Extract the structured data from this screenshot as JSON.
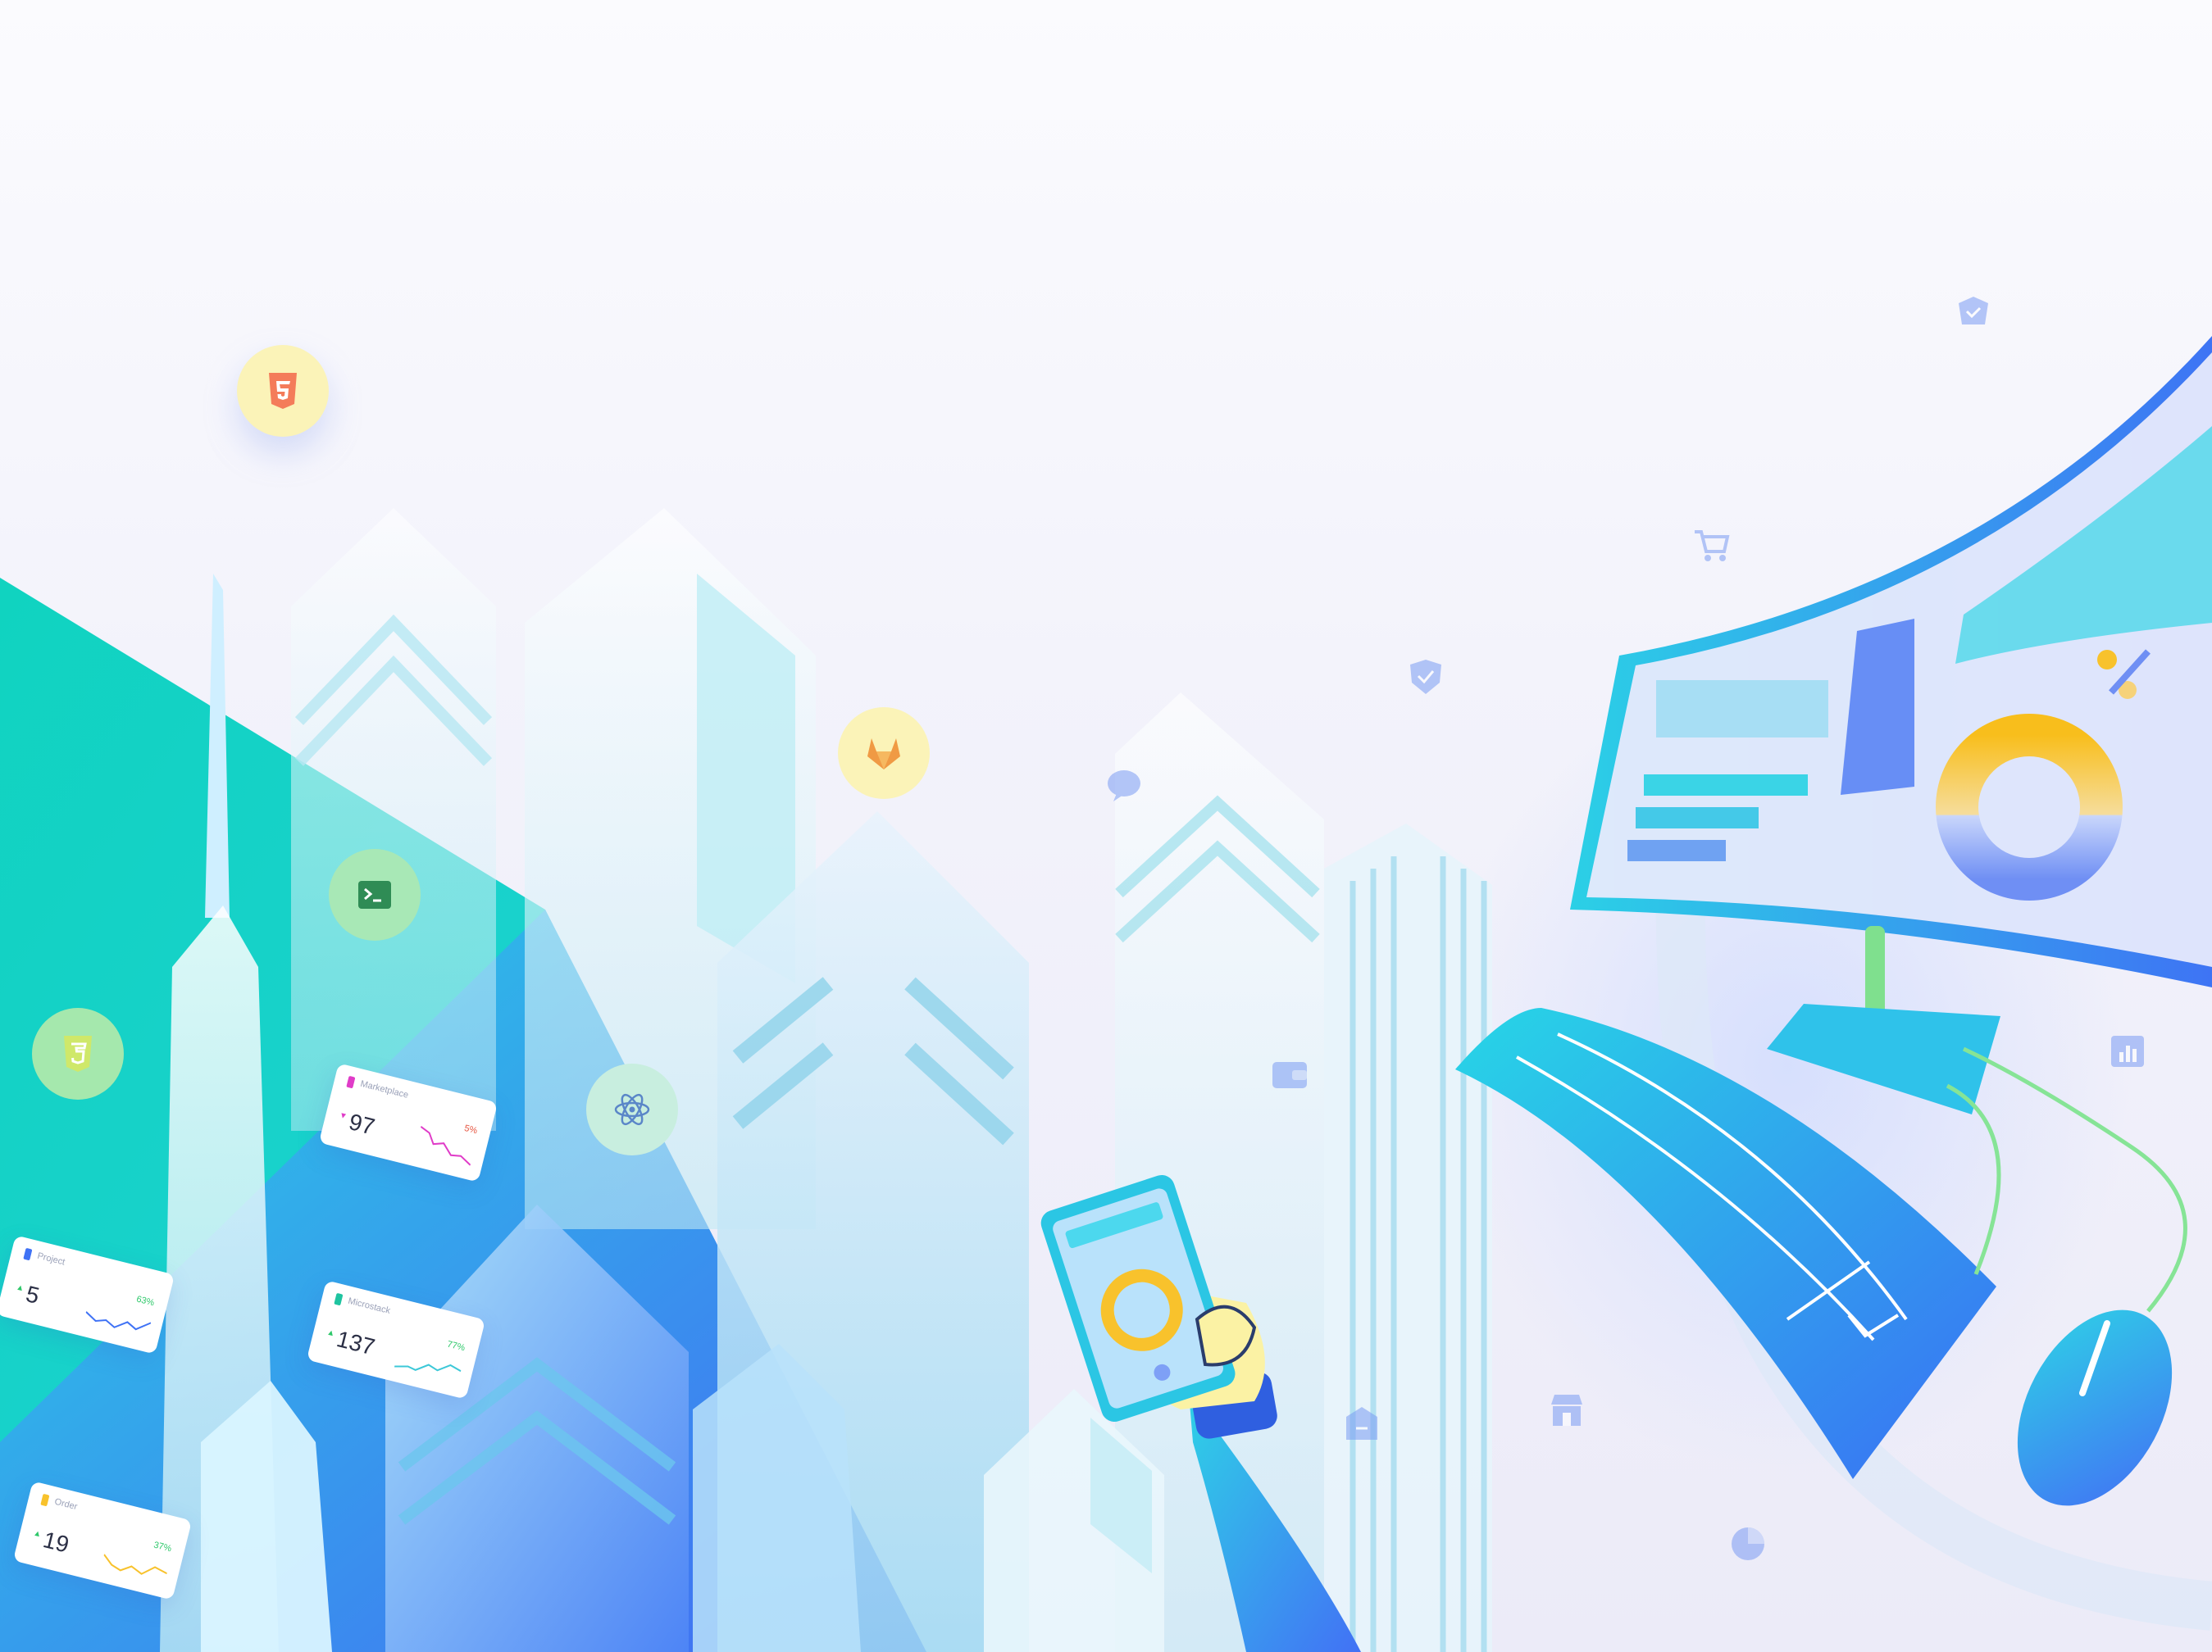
{
  "illustration": {
    "accent_colors": {
      "teal": "#1ad2c6",
      "cyan": "#2ad4e6",
      "blue": "#3f72f5",
      "yellow": "#f8c22c",
      "pink": "#e03cc8",
      "green": "#2ec86a"
    },
    "stat_cards": [
      {
        "label": "Marketplace",
        "value": "97",
        "trend": "down",
        "percent": "5%",
        "tag_color": "#e03cc8",
        "line_color": "#e03cc8"
      },
      {
        "label": "Project",
        "value": "5",
        "trend": "up",
        "percent": "63%",
        "tag_color": "#3f72f5",
        "line_color": "#3f72f5"
      },
      {
        "label": "Microstack",
        "value": "137",
        "trend": "up",
        "percent": "77%",
        "tag_color": "#1fc4a0",
        "line_color": "#3cc8d8"
      },
      {
        "label": "Order",
        "value": "19",
        "trend": "up",
        "percent": "37%",
        "tag_color": "#f8c22c",
        "line_color": "#f8c22c"
      }
    ],
    "tech_bubbles": [
      {
        "icon": "html5-icon"
      },
      {
        "icon": "terminal-icon"
      },
      {
        "icon": "css3-icon"
      },
      {
        "icon": "gitlab-icon"
      },
      {
        "icon": "react-icon"
      }
    ],
    "floating_icons": [
      "inbox-icon",
      "cart-icon",
      "shield-check-icon",
      "chat-icon",
      "wallet-icon",
      "chart-icon",
      "store-icon",
      "tag-icon",
      "pie-icon"
    ]
  }
}
